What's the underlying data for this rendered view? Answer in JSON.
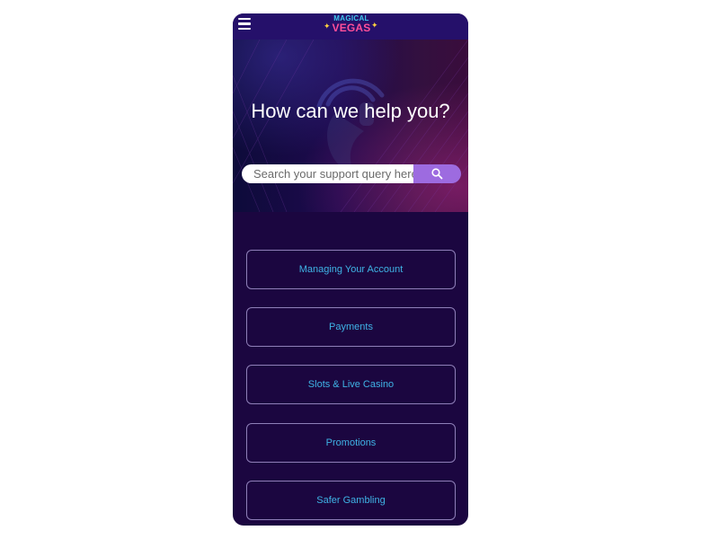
{
  "header": {
    "logo_top": "MAGICAL",
    "logo_bottom": "VEGAS",
    "menu_icon": "hamburger-menu-icon"
  },
  "hero": {
    "title": "How can we help you?",
    "background_icon": "headset-icon"
  },
  "search": {
    "placeholder": "Search your support query here",
    "button_icon": "search-icon"
  },
  "categories": [
    {
      "label": "Managing Your Account"
    },
    {
      "label": "Payments"
    },
    {
      "label": "Slots & Live Casino"
    },
    {
      "label": "Promotions"
    },
    {
      "label": "Safer Gambling"
    }
  ],
  "colors": {
    "topbar": "#25106a",
    "page_background": "#1b0640",
    "search_button": "#9d6be0",
    "category_text": "#3fb3e6",
    "category_border": "#8e7fb8",
    "logo_cyan": "#3fc8ee",
    "logo_pink": "#ff4f9a"
  }
}
